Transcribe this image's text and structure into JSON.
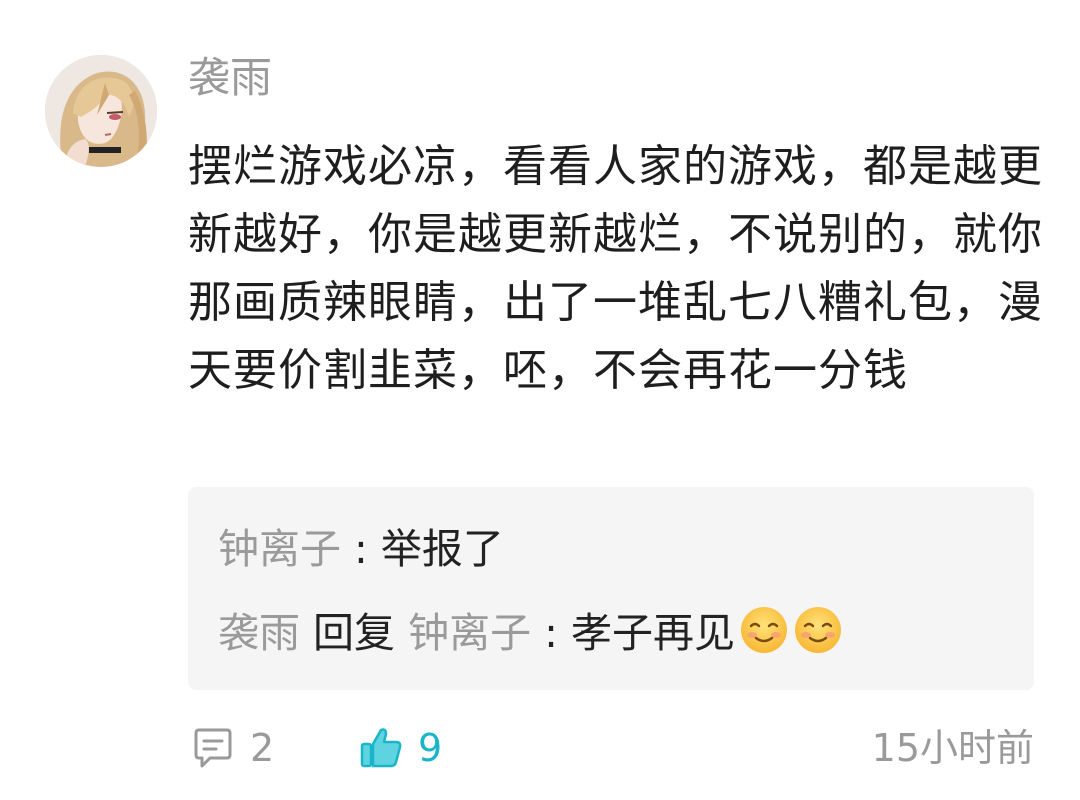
{
  "comment": {
    "username": "袭雨",
    "avatar_icon": "anime-girl-avatar",
    "content": "摆烂游戏必凉，看看人家的游戏，都是越更新越好，你是越更新越烂，不说别的，就你那画质辣眼睛，出了一堆乱七八糟礼包，漫天要价割韭菜，呸，不会再花一分钱"
  },
  "replies": [
    {
      "author": "钟离子",
      "separator": " : ",
      "text": "举报了"
    },
    {
      "author": "袭雨",
      "reply_word": " 回复 ",
      "target": "钟离子",
      "separator": " : ",
      "text": "孝子再见",
      "emojis": [
        "smiling-face-emoji",
        "smiling-face-emoji"
      ]
    }
  ],
  "footer": {
    "comment_icon": "comment-bubble-icon",
    "comment_count": "2",
    "like_icon": "thumbs-up-icon",
    "like_count": "9",
    "timestamp": "15小时前"
  },
  "colors": {
    "accent": "#19b5c8",
    "muted": "#9a9a9a",
    "text": "#1e1e1e",
    "reply_bg": "#f5f5f5"
  }
}
